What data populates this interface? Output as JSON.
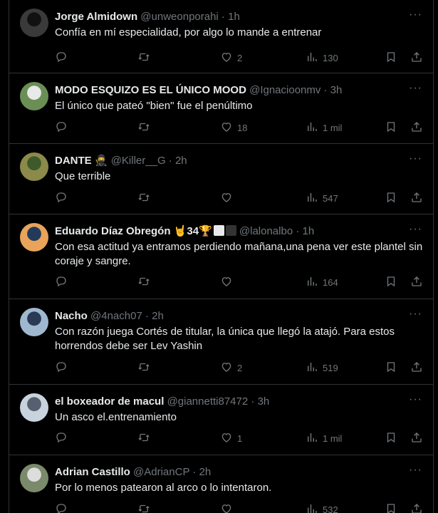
{
  "colors": {
    "background": "#000000",
    "text": "#e7e9ea",
    "muted": "#71767b",
    "border": "#2f3336"
  },
  "icons": {
    "reply": "reply-icon",
    "retweet": "retweet-icon",
    "like": "heart-icon",
    "views": "views-icon",
    "bookmark": "bookmark-icon",
    "share": "share-icon",
    "more": "more-icon"
  },
  "tweets": [
    {
      "name": "Jorge Almidown",
      "handle": "@unweonporahi",
      "time": "1h",
      "text": "Confía en mí especialidad, por algo lo mande a entrenar",
      "likes": "2",
      "views": "130"
    },
    {
      "name": "MODO ESQUIZO ES EL ÚNICO MOOD",
      "handle": "@Ignacioonmv",
      "time": "3h",
      "text": "El único que pateó \"bien\" fue el penúltimo",
      "likes": "18",
      "views": "1 mil"
    },
    {
      "name": "DANTE 🥷",
      "handle": "@Killer__G",
      "time": "2h",
      "text": "Que terrible",
      "likes": "",
      "views": "547"
    },
    {
      "name": "Eduardo Díaz Obregón 🤘34🏆",
      "handle": "@lalonalbo",
      "time": "1h",
      "text": "Con esa actitud ya entramos perdiendo mañana,una pena ver este plantel sin coraje y sangre.",
      "likes": "",
      "views": "164"
    },
    {
      "name": "Nacho",
      "handle": "@4nach07",
      "time": "2h",
      "text": "Con razón juega Cortés de titular, la única que llegó la atajó. Para estos horrendos debe ser Lev Yashin",
      "likes": "2",
      "views": "519"
    },
    {
      "name": "el boxeador de macul",
      "handle": "@giannetti87472",
      "time": "3h",
      "text": "Un asco el.entrenamiento",
      "likes": "1",
      "views": "1 mil"
    },
    {
      "name": "Adrian Castillo",
      "handle": "@AdrianCP",
      "time": "2h",
      "text": "Por lo menos patearon al arco o lo intentaron.",
      "likes": "",
      "views": "532"
    }
  ]
}
